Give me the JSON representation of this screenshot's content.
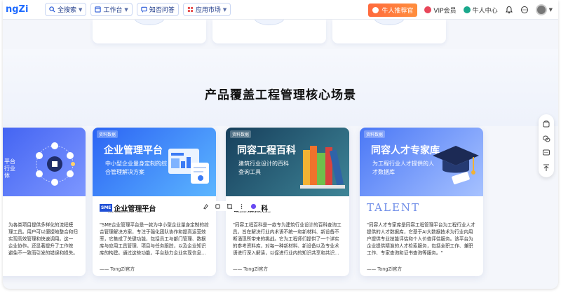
{
  "nav": {
    "logo": "ngZi",
    "pills": [
      {
        "label": "全搜索",
        "icon": "search-icon"
      },
      {
        "label": "工作台",
        "icon": "workbench-icon"
      },
      {
        "label": "知否问答",
        "icon": "qa-icon"
      },
      {
        "label": "应用市场",
        "icon": "apps-icon"
      }
    ],
    "promo": "牛人推荐官",
    "vip": "VIP会员",
    "center": "牛人中心"
  },
  "section": {
    "title": "产品覆盖工程管理核心场景"
  },
  "cards": [
    {
      "badge": "",
      "title": "",
      "subtitle": "",
      "partial_title_lines": [
        "平台",
        "行业",
        "体"
      ],
      "logo_text": "",
      "desc_lines": [
        "为各类项目提供多样化的流程模",
        "理工具。用户可以便捷地整合和归",
        "实现高效管理和快速调用。这一",
        "企业协作。还显著提升了工作效",
        "避免不一致而引发的错误和损失。"
      ],
      "signature": "",
      "colors": [
        "#3a63f5",
        "#6c8cff"
      ]
    },
    {
      "badge": "资料数据",
      "title": "企业管理平台",
      "subtitle": "中小型企业量身定制的综合管理解决方案",
      "logo_mark": "SME",
      "logo_text": "企业管理平台",
      "logo_small": "SME-MANAGEMENT-PLATFORM",
      "desc_lines": [
        "\"SME企业管理平台是一款为中小型企业量身定制的综",
        "合管理解决方案，专注于强化团队协作和提高运营效",
        "率，它集成了关键功能，包括员工与部门管理、数据",
        "库与应用工具管理、项目与任务跟踪，以及企业知识",
        "库的构建。通过这些功能，平台助力企业实现信息…"
      ],
      "signature": "—— TongZi官方",
      "colors": [
        "#2b6af6",
        "#57b3ff"
      ]
    },
    {
      "badge": "资料数据",
      "title": "同容工程百科",
      "subtitle": "建筑行业设计的百科查询工具",
      "logo_text": "容工程百科",
      "logo_small": "TONGZI-ENGINEER-BAIKE",
      "desc_lines": [
        "\"同容工程百科是一款专为建筑行业设计的百科查询工",
        "具，旨在解决行业内术语不统一和新材料、新设备不",
        "断涌现所带来的挑战。它为工程师们提供了一个详实",
        "的参考资料库，对每一种新材料、新设备以及专业术",
        "语进行深入解读，以促进行业内的知识共享和共识…"
      ],
      "signature": "—— TongZi官方",
      "colors": [
        "#1e4b66",
        "#3d7f8f"
      ]
    },
    {
      "badge": "资料数据",
      "title": "同容人才专家库",
      "subtitle": "为工程行业人才提供的人才数据库",
      "logo_text": "TALENT",
      "desc_lines": [
        "\"同容人才专家库是同容工程管理平台为工程行业人才",
        "提供的人才数据库，它基于AI大数据技术为行业内用",
        "户提供专业技能评估和个人价值评估服务。该平台为",
        "企业提供精准的人才检索服务，包括全职工作、兼职",
        "工作、专家查询和证书查询等服务。\""
      ],
      "signature": "—— TongZi官方",
      "colors": [
        "#4f7bf7",
        "#9bb8ff"
      ]
    }
  ]
}
